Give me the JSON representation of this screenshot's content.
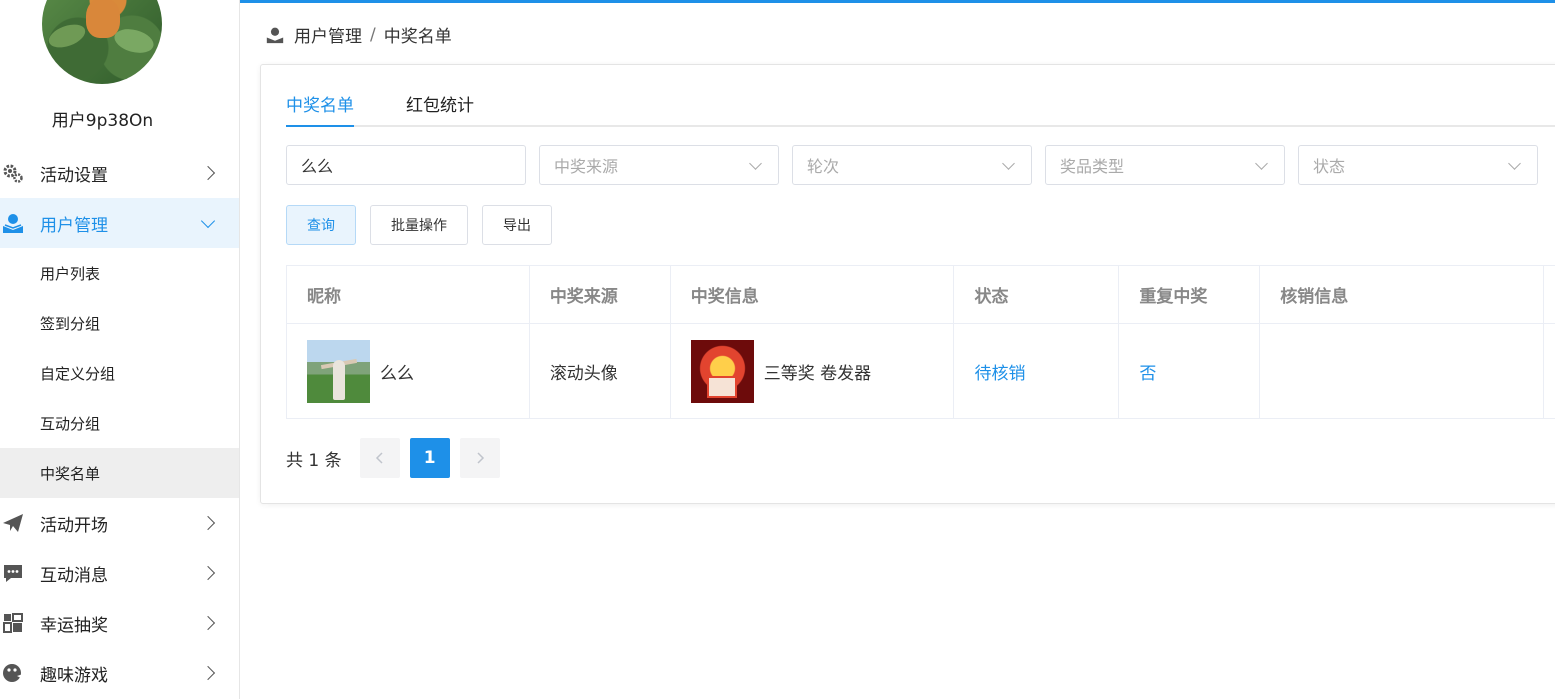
{
  "sidebar": {
    "username": "用户9p38On",
    "menu": [
      {
        "label": "活动设置",
        "icon": "gears-icon"
      },
      {
        "label": "用户管理",
        "icon": "user-manage-icon",
        "active": true
      },
      {
        "label": "活动开场",
        "icon": "paper-plane-icon"
      },
      {
        "label": "互动消息",
        "icon": "chat-bubble-icon"
      },
      {
        "label": "幸运抽奖",
        "icon": "lottery-icon"
      },
      {
        "label": "趣味游戏",
        "icon": "gamepad-icon"
      }
    ],
    "submenu": [
      "用户列表",
      "签到分组",
      "自定义分组",
      "互动分组",
      "中奖名单"
    ]
  },
  "breadcrumb": {
    "root": "用户管理",
    "sep": "/",
    "current": "中奖名单"
  },
  "tabs": [
    {
      "label": "中奖名单",
      "active": true
    },
    {
      "label": "红包统计"
    }
  ],
  "filters": {
    "keyword": "么么",
    "source_placeholder": "中奖来源",
    "round_placeholder": "轮次",
    "prize_type_placeholder": "奖品类型",
    "status_placeholder": "状态"
  },
  "buttons": {
    "query": "查询",
    "batch": "批量操作",
    "export": "导出"
  },
  "table": {
    "headers": [
      "昵称",
      "中奖来源",
      "中奖信息",
      "状态",
      "重复中奖",
      "核销信息"
    ],
    "rows": [
      {
        "nickname": "么么",
        "source": "滚动头像",
        "info": "三等奖 卷发器",
        "status": "待核销",
        "repeat": "否",
        "verify": ""
      }
    ]
  },
  "pagination": {
    "total": "共 1 条",
    "current": "1"
  },
  "colors": {
    "accent": "#1e90e8"
  }
}
